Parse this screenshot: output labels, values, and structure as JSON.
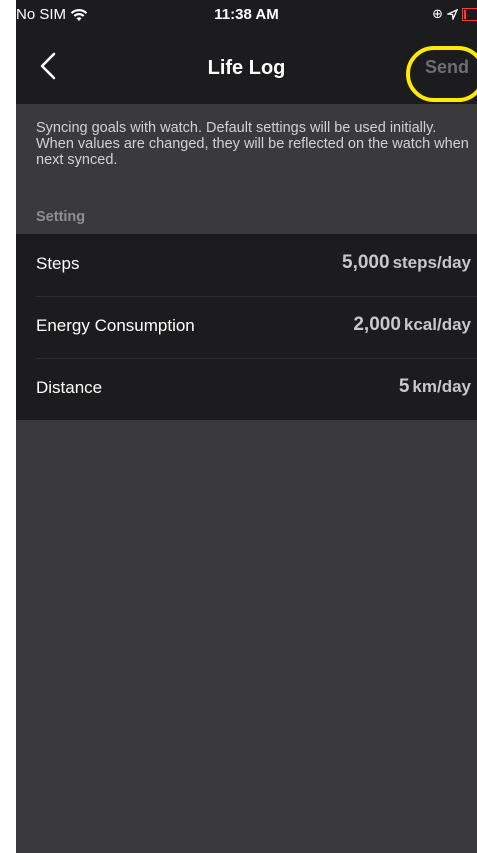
{
  "status_bar": {
    "carrier": "No SIM",
    "time": "11:38 AM"
  },
  "navbar": {
    "title": "Life Log",
    "send_label": "Send"
  },
  "info_text": "Syncing goals with watch. Default settings will be used initially. When values are changed, they will be reflected on the watch when next synced.",
  "section_header": "Setting",
  "settings": [
    {
      "label": "Steps",
      "value": "5,000",
      "unit": "steps/day"
    },
    {
      "label": "Energy Consumption",
      "value": "2,000",
      "unit": "kcal/day"
    },
    {
      "label": "Distance",
      "value": "5",
      "unit": "km/day"
    }
  ],
  "colors": {
    "highlight": "#ffeb00",
    "battery": "#ff3b30"
  }
}
